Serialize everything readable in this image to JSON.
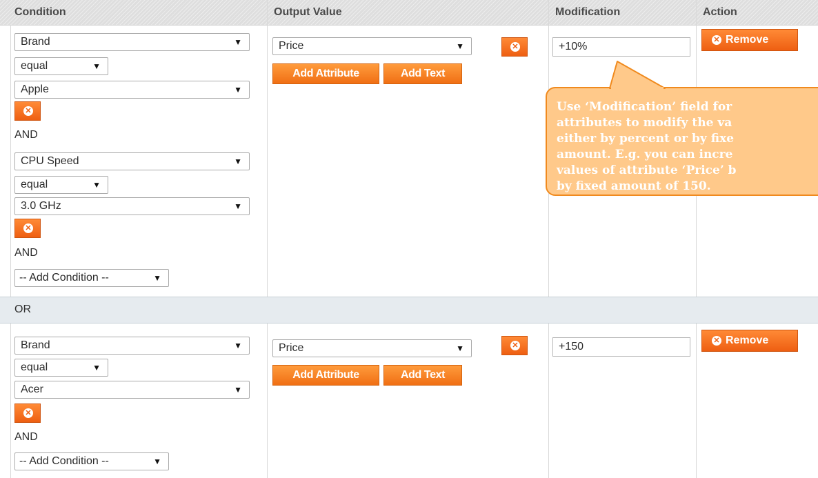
{
  "header": {
    "condition": "Condition",
    "output_value": "Output Value",
    "modification": "Modification",
    "action": "Action"
  },
  "or_label": "OR",
  "rule1": {
    "conditions": [
      {
        "attribute": "Brand",
        "operator": "equal",
        "value": "Apple"
      },
      {
        "attribute": "CPU Speed",
        "operator": "equal",
        "value": "3.0 GHz"
      }
    ],
    "and_label": "AND",
    "add_condition": "-- Add Condition --",
    "output": "Price",
    "add_attribute": "Add Attribute",
    "add_text": "Add Text",
    "modification": "+10%",
    "remove": "Remove"
  },
  "rule2": {
    "conditions": [
      {
        "attribute": "Brand",
        "operator": "equal",
        "value": "Acer"
      }
    ],
    "and_label": "AND",
    "add_condition": "-- Add Condition --",
    "output": "Price",
    "add_attribute": "Add Attribute",
    "add_text": "Add Text",
    "modification": "+150",
    "remove": "Remove"
  },
  "tooltip": {
    "lines": [
      "Use ‘Modification’ field for",
      "attributes to modify the va",
      "either by percent or by fixe",
      "amount. E.g. you can incre",
      "values of attribute ‘Price’ b",
      "by fixed amount of 150."
    ]
  },
  "icons": {
    "dropdown": "triangle-down-icon",
    "delete": "circle-x-icon"
  },
  "colors": {
    "button_orange": "#f07a1a",
    "tooltip_fill": "#ffc98a",
    "tooltip_border": "#f08a1e",
    "or_band": "#e6ebef"
  }
}
